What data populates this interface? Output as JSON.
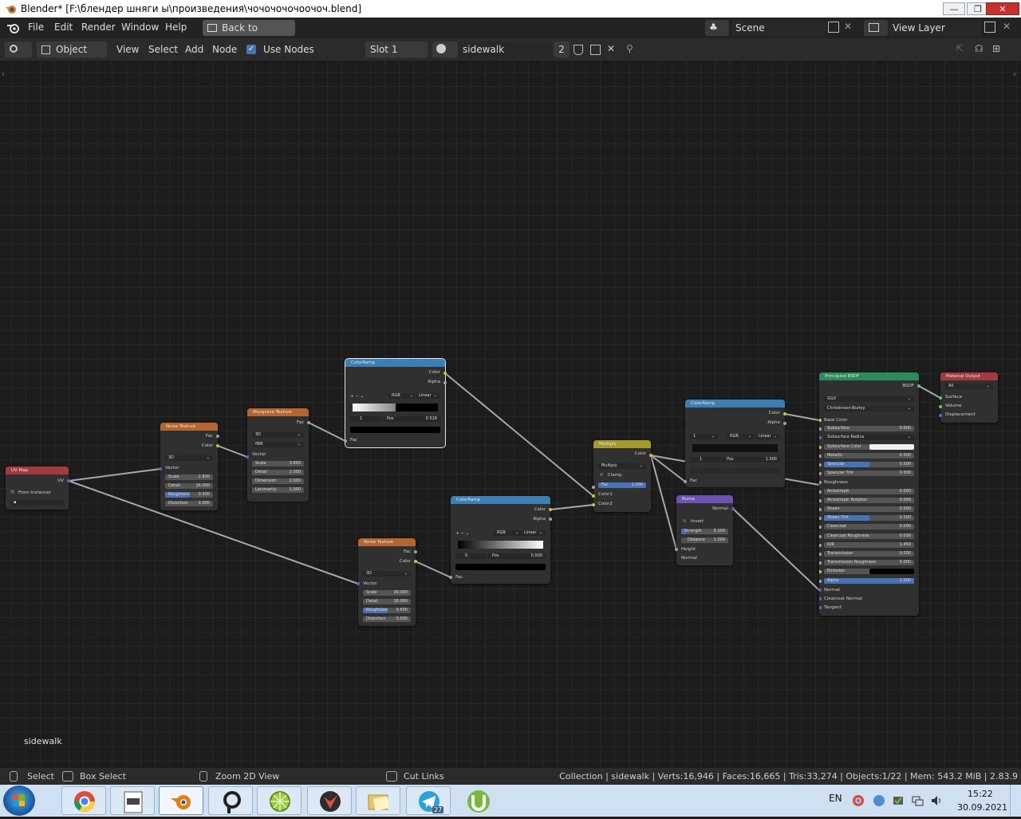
{
  "window": {
    "title": "Blender* [F:\\блендер шняги ы\\произведения\\чочочочочоочоч.blend]",
    "min": "—",
    "max": "❐",
    "close": "✕"
  },
  "menu": {
    "items": [
      "File",
      "Edit",
      "Render",
      "Window",
      "Help"
    ],
    "back": "Back to Previous",
    "scene": "Scene",
    "view_layer": "View Layer"
  },
  "header": {
    "mode": "Object",
    "view": "View",
    "select": "Select",
    "add": "Add",
    "node": "Node",
    "use_nodes": "Use Nodes",
    "slot": "Slot 1",
    "material": "sidewalk",
    "users": "2"
  },
  "canvas_label": "sidewalk",
  "nodes": {
    "uvmap": {
      "title": "UV Map",
      "out": "UV",
      "from_instancer": "From Instancer"
    },
    "noise1": {
      "title": "Noise Texture",
      "fac": "Fac",
      "color": "Color",
      "dim": "3D",
      "vector": "Vector",
      "scale_l": "Scale",
      "scale_v": "2.800",
      "detail_l": "Detail",
      "detail_v": "16.000",
      "rough_l": "Roughness",
      "rough_v": "0.500",
      "dist_l": "Distortion",
      "dist_v": "0.000"
    },
    "musgrave": {
      "title": "Musgrave Texture",
      "fac": "Fac",
      "dim": "3D",
      "type": "fBM",
      "vector": "Vector",
      "scale_l": "Scale",
      "scale_v": "0.800",
      "detail_l": "Detail",
      "detail_v": "2.000",
      "dimension_l": "Dimension",
      "dimension_v": "2.000",
      "lac_l": "Lacunarity",
      "lac_v": "1.000"
    },
    "ramp1": {
      "title": "ColorRamp",
      "color": "Color",
      "alpha": "Alpha",
      "plus": "+",
      "minus": "−",
      "mode": "RGB",
      "interp": "Linear",
      "idx": "1",
      "pos_l": "Pos",
      "pos_v": "0.518",
      "fac": "Fac"
    },
    "multiply": {
      "title": "Multiply",
      "color": "Color",
      "op": "Multiply",
      "clamp": "Clamp",
      "fac_l": "Fac",
      "fac_v": "1.000",
      "c1": "Color1",
      "c2": "Color2"
    },
    "ramp2": {
      "title": "ColorRamp",
      "color": "Color",
      "alpha": "Alpha",
      "idx": "1",
      "mode": "RGB",
      "interp": "Linear",
      "idx2": "1",
      "pos_l": "Pos",
      "pos_v": "1.000",
      "fac": "Fac"
    },
    "ramp3": {
      "title": "ColorRamp",
      "color": "Color",
      "alpha": "Alpha",
      "plus": "+",
      "minus": "−",
      "mode": "RGB",
      "interp": "Linear",
      "idx": "0",
      "pos_l": "Pos",
      "pos_v": "0.000",
      "fac": "Fac"
    },
    "noise2": {
      "title": "Noise Texture",
      "fac": "Fac",
      "color": "Color",
      "dim": "3D",
      "vector": "Vector",
      "scale_l": "Scale",
      "scale_v": "30.000",
      "detail_l": "Detail",
      "detail_v": "16.000",
      "rough_l": "Roughness",
      "rough_v": "0.500",
      "dist_l": "Distortion",
      "dist_v": "0.000"
    },
    "bump": {
      "title": "Bump",
      "normal": "Normal",
      "invert": "Invert",
      "strength_l": "Strength",
      "strength_v": "0.100",
      "distance_l": "Distance",
      "distance_v": "1.000",
      "height": "Height",
      "normal_in": "Normal"
    },
    "bsdf": {
      "title": "Principled BSDF",
      "out": "BSDF",
      "dist": "GGX",
      "sss": "Christensen-Burley",
      "rows": [
        [
          "Base Color",
          ""
        ],
        [
          "Subsurface",
          "0.000"
        ],
        [
          "Subsurface Radius",
          ""
        ],
        [
          "Subsurface Color",
          ""
        ],
        [
          "Metallic",
          "0.000"
        ],
        [
          "Specular",
          "0.500"
        ],
        [
          "Specular Tint",
          "0.000"
        ],
        [
          "Roughness",
          ""
        ],
        [
          "Anisotropic",
          "0.000"
        ],
        [
          "Anisotropic Rotation",
          "0.000"
        ],
        [
          "Sheen",
          "0.000"
        ],
        [
          "Sheen Tint",
          "0.500"
        ],
        [
          "Clearcoat",
          "0.000"
        ],
        [
          "Clearcoat Roughness",
          "0.030"
        ],
        [
          "IOR",
          "1.450"
        ],
        [
          "Transmission",
          "0.000"
        ],
        [
          "Transmission Roughness",
          "0.000"
        ],
        [
          "Emission",
          ""
        ],
        [
          "Alpha",
          "1.000"
        ],
        [
          "Normal",
          ""
        ],
        [
          "Clearcoat Normal",
          ""
        ],
        [
          "Tangent",
          ""
        ]
      ]
    },
    "output": {
      "title": "Material Output",
      "target": "All",
      "surface": "Surface",
      "volume": "Volume",
      "displacement": "Displacement"
    }
  },
  "status": {
    "select": "Select",
    "box_select": "Box Select",
    "zoom": "Zoom 2D View",
    "cut": "Cut Links",
    "stats": "Collection | sidewalk | Verts:16,946 | Faces:16,665 | Tris:33,274 | Objects:1/22 | Mem: 543.2 MiB | 2.83.9"
  },
  "taskbar": {
    "lang": "EN",
    "time": "15:22",
    "date": "30.09.2021",
    "telegram_badge": "27"
  },
  "colors": {
    "input_header": "#a33a3f",
    "texture_header": "#b5662d",
    "converter_header": "#3a7fb5",
    "color_header": "#a59a2c",
    "vector_header": "#6a53b5",
    "shader_header": "#2c8b5a",
    "output_header": "#a33a3f",
    "socket_yellow": "#c7c729",
    "socket_gray": "#a1a1a1",
    "socket_purple": "#6363c7",
    "socket_green": "#63c763"
  }
}
